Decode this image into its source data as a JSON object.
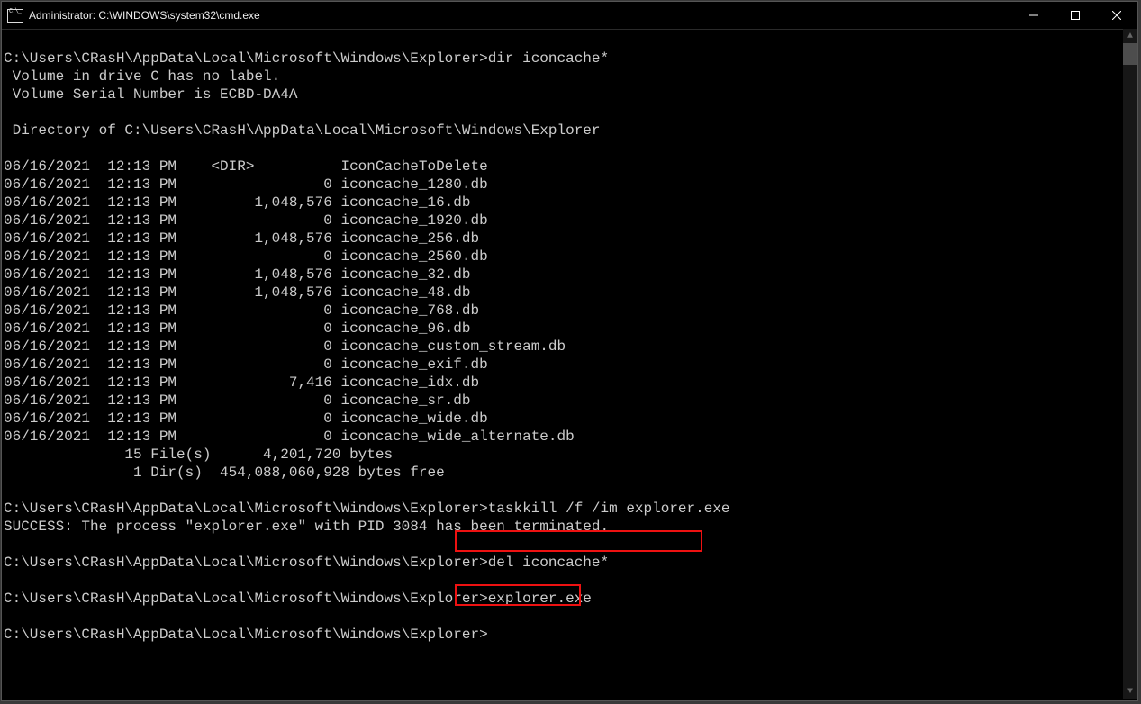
{
  "window": {
    "title": "Administrator: C:\\WINDOWS\\system32\\cmd.exe"
  },
  "prompts": {
    "p1_path": "C:\\Users\\CRasH\\AppData\\Local\\Microsoft\\Windows\\Explorer>",
    "p1_cmd": "dir iconcache*",
    "vol1": " Volume in drive C has no label.",
    "vol2": " Volume Serial Number is ECBD-DA4A",
    "dirof": " Directory of C:\\Users\\CRasH\\AppData\\Local\\Microsoft\\Windows\\Explorer",
    "rows": [
      "06/16/2021  12:13 PM    <DIR>          IconCacheToDelete",
      "06/16/2021  12:13 PM                 0 iconcache_1280.db",
      "06/16/2021  12:13 PM         1,048,576 iconcache_16.db",
      "06/16/2021  12:13 PM                 0 iconcache_1920.db",
      "06/16/2021  12:13 PM         1,048,576 iconcache_256.db",
      "06/16/2021  12:13 PM                 0 iconcache_2560.db",
      "06/16/2021  12:13 PM         1,048,576 iconcache_32.db",
      "06/16/2021  12:13 PM         1,048,576 iconcache_48.db",
      "06/16/2021  12:13 PM                 0 iconcache_768.db",
      "06/16/2021  12:13 PM                 0 iconcache_96.db",
      "06/16/2021  12:13 PM                 0 iconcache_custom_stream.db",
      "06/16/2021  12:13 PM                 0 iconcache_exif.db",
      "06/16/2021  12:13 PM             7,416 iconcache_idx.db",
      "06/16/2021  12:13 PM                 0 iconcache_sr.db",
      "06/16/2021  12:13 PM                 0 iconcache_wide.db",
      "06/16/2021  12:13 PM                 0 iconcache_wide_alternate.db"
    ],
    "summary1": "              15 File(s)      4,201,720 bytes",
    "summary2": "               1 Dir(s)  454,088,060,928 bytes free",
    "p2_path": "C:\\Users\\CRasH\\AppData\\Local\\Microsoft\\Windows\\Explorer>",
    "p2_cmd": "taskkill /f /im explorer.exe",
    "success": "SUCCESS: The process \"explorer.exe\" with PID 3084 has been terminated.",
    "p3_path": "C:\\Users\\CRasH\\AppData\\Local\\Microsoft\\Windows\\Explorer>",
    "p3_cmd": "del iconcache*",
    "p4_path": "C:\\Users\\CRasH\\AppData\\Local\\Microsoft\\Windows\\Explorer>",
    "p4_cmd": "explorer.exe",
    "p5_path": "C:\\Users\\CRasH\\AppData\\Local\\Microsoft\\Windows\\Explorer>"
  }
}
